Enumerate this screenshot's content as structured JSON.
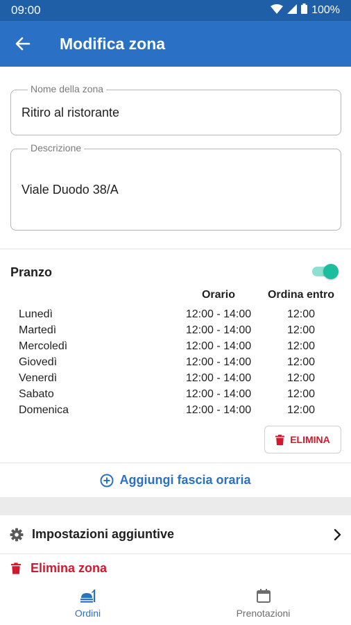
{
  "status_bar": {
    "time": "09:00",
    "battery": "100%"
  },
  "app_bar": {
    "title": "Modifica zona"
  },
  "form": {
    "zone_name_label": "Nome della zona",
    "zone_name_value": "Ritiro al ristorante",
    "description_label": "Descrizione",
    "description_value": "Viale Duodo 38/A"
  },
  "pranzo": {
    "title": "Pranzo",
    "enabled": true,
    "col_orario": "Orario",
    "col_entro": "Ordina entro",
    "rows": [
      {
        "day": "Lunedì",
        "orario": "12:00 - 14:00",
        "entro": "12:00"
      },
      {
        "day": "Martedì",
        "orario": "12:00 - 14:00",
        "entro": "12:00"
      },
      {
        "day": "Mercoledì",
        "orario": "12:00 - 14:00",
        "entro": "12:00"
      },
      {
        "day": "Giovedì",
        "orario": "12:00 - 14:00",
        "entro": "12:00"
      },
      {
        "day": "Venerdì",
        "orario": "12:00 - 14:00",
        "entro": "12:00"
      },
      {
        "day": "Sabato",
        "orario": "12:00 - 14:00",
        "entro": "12:00"
      },
      {
        "day": "Domenica",
        "orario": "12:00 - 14:00",
        "entro": "12:00"
      }
    ],
    "delete_label": "ELIMINA"
  },
  "add_slot_label": "Aggiungi fascia oraria",
  "settings_label": "Impostazioni aggiuntive",
  "delete_zone_label": "Elimina zona",
  "bottom_nav": {
    "items": [
      {
        "label": "Ordini",
        "icon": "orders-icon",
        "active": true
      },
      {
        "label": "Prenotazioni",
        "icon": "calendar-icon",
        "active": false
      }
    ]
  },
  "colors": {
    "primary": "#2a71c6",
    "status_bar": "#1e5fa8",
    "danger": "#d0192e",
    "toggle_on": "#1bbf9f"
  }
}
